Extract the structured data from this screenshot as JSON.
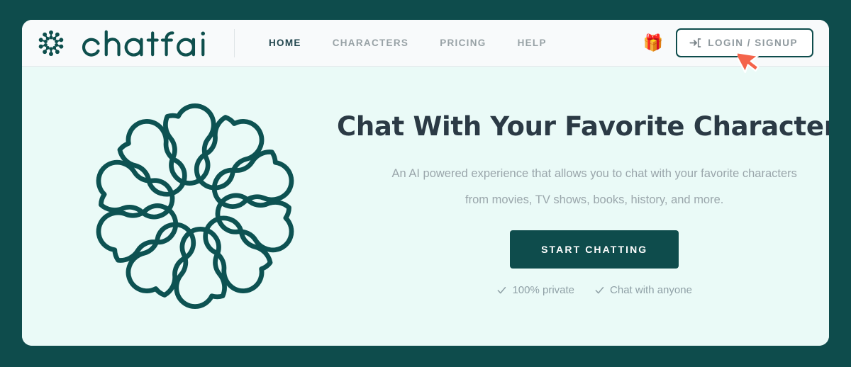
{
  "theme": {
    "frame_color": "#0e4c4c",
    "card_color": "#ffffff",
    "header_color": "#f8fafb",
    "hero_color": "#eafaf7",
    "brand_color": "#0e4f4d",
    "accent_color": "#0e4c4c",
    "muted_text_color": "#9aa6ab",
    "heading_color": "#2b3a45",
    "cursor_color": "#f4644b"
  },
  "header": {
    "brand_name": "chatfai",
    "brand_mark_icon": "molecule-logo-icon",
    "nav": [
      {
        "label": "HOME",
        "active": true
      },
      {
        "label": "CHARACTERS",
        "active": false
      },
      {
        "label": "PRICING",
        "active": false
      },
      {
        "label": "HELP",
        "active": false
      }
    ],
    "gift_icon": "🎁",
    "login": {
      "label": "LOGIN / SIGNUP",
      "icon": "sign-in-icon"
    }
  },
  "hero": {
    "art_icon": "molecule-network-illustration",
    "title": "Chat With Your Favorite Characters",
    "subtitle": "An AI powered experience that allows you to chat with your favorite characters",
    "subtitle_2": "from movies, TV shows, books, history, and more.",
    "cta_label": "START CHATTING",
    "features": [
      {
        "icon": "check-icon",
        "label": "100% private"
      },
      {
        "icon": "check-icon",
        "label": "Chat with anyone"
      }
    ]
  },
  "cursor": {
    "icon": "mouse-pointer-icon"
  }
}
